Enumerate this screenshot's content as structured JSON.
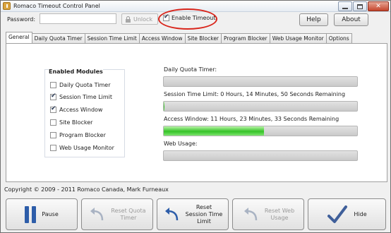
{
  "window": {
    "title": "Romaco Timeout Control Panel"
  },
  "header": {
    "password_label": "Password:",
    "password_value": "",
    "unlock_label": "Unlock",
    "enable_timeout_label": "Enable Timeout",
    "enable_timeout_checked": true,
    "help_label": "Help",
    "about_label": "About"
  },
  "tabs": [
    {
      "label": "General",
      "active": true
    },
    {
      "label": "Daily Quota Timer"
    },
    {
      "label": "Session Time Limit"
    },
    {
      "label": "Access Window"
    },
    {
      "label": "Site Blocker"
    },
    {
      "label": "Program Blocker"
    },
    {
      "label": "Web Usage Monitor"
    },
    {
      "label": "Options"
    }
  ],
  "modules": {
    "title": "Enabled Modules",
    "items": [
      {
        "label": "Daily Quota Timer",
        "checked": false
      },
      {
        "label": "Session Time Limit",
        "checked": true
      },
      {
        "label": "Access Window",
        "checked": true
      },
      {
        "label": "Site Blocker",
        "checked": false
      },
      {
        "label": "Program Blocker",
        "checked": false
      },
      {
        "label": "Web Usage Monitor",
        "checked": false
      }
    ]
  },
  "status": [
    {
      "label": "Daily Quota Timer:",
      "progress": 0
    },
    {
      "label": "Session Time Limit: 0 Hours, 14 Minutes, 50 Seconds Remaining",
      "progress": 0.005
    },
    {
      "label": "Access Window: 11 Hours, 23 Minutes, 33 Seconds Remaining",
      "progress": 0.52
    },
    {
      "label": "Web Usage:",
      "progress": 0
    }
  ],
  "footer": {
    "copyright": "Copyright © 2009 - 2011 Romaco Canada, Mark Furneaux"
  },
  "buttons": {
    "pause": "Pause",
    "reset_quota_line1": "Reset Quota",
    "reset_quota_line2": "Timer",
    "reset_session_line1": "Reset",
    "reset_session_line2": "Session Time",
    "reset_session_line3": "Limit",
    "reset_web_line1": "Reset Web",
    "reset_web_line2": "Usage",
    "hide": "Hide"
  },
  "colors": {
    "pause_icon": "#2d5da9",
    "hide_check": "#3f5f9a",
    "progress_fill": "#35c227",
    "highlight_ellipse": "#d9261c"
  }
}
